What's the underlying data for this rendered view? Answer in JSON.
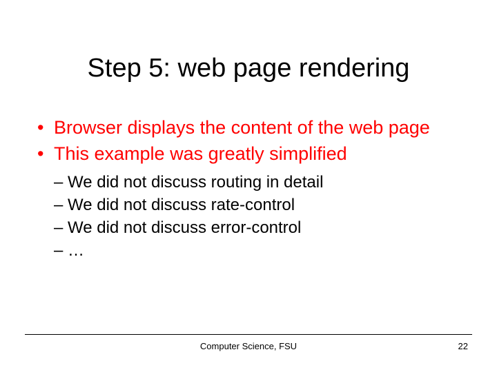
{
  "title": "Step 5: web page rendering",
  "bullets": {
    "b0": "Browser displays the content of the web page",
    "b1": "This example was greatly simplified",
    "sub": {
      "s0": "We did not discuss routing in detail",
      "s1": "We did not discuss rate-control",
      "s2": "We did not discuss error-control",
      "s3": "…"
    }
  },
  "footer": {
    "center": "Computer Science, FSU",
    "page": "22"
  }
}
